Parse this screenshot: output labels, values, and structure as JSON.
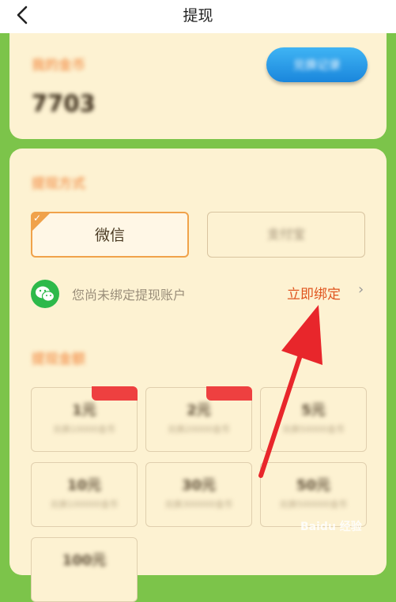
{
  "header": {
    "title": "提现",
    "back_glyph": "‹"
  },
  "coins": {
    "label": "我的金币",
    "value": "7703",
    "record_button": "兑换记录"
  },
  "method": {
    "label": "提现方式",
    "options": [
      {
        "label": "微信",
        "selected": true
      },
      {
        "label": "支付宝",
        "selected": false
      }
    ]
  },
  "bind": {
    "message": "您尚未绑定提现账户",
    "link": "立即绑定",
    "chevron": "›"
  },
  "amount": {
    "label": "提现金额",
    "items": [
      {
        "value": "1元",
        "note": "兑换10000金币",
        "badge": true
      },
      {
        "value": "2元",
        "note": "兑换20000金币",
        "badge": true
      },
      {
        "value": "5元",
        "note": "兑换50000金币",
        "badge": false
      },
      {
        "value": "10元",
        "note": "兑换100000金币",
        "badge": false
      },
      {
        "value": "30元",
        "note": "兑换300000金币",
        "badge": false
      },
      {
        "value": "50元",
        "note": "兑换500000金币",
        "badge": false
      },
      {
        "value": "100元",
        "note": "",
        "badge": false
      }
    ]
  },
  "watermark": "Baidu 经验",
  "colors": {
    "accent": "#e0551f",
    "background": "#7cc44a",
    "card": "#fdf2d2",
    "wechat": "#2db94a"
  }
}
